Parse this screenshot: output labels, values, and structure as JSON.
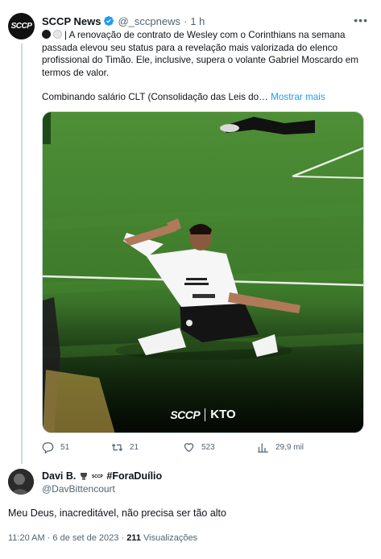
{
  "tweet": {
    "author_name": "SCCP News",
    "avatar_text": "SCCP",
    "handle": "@_sccpnews",
    "separator": "·",
    "time": "1 h",
    "text_para1": "| A renovação de contrato de Wesley com o Corinthians na semana passada elevou seu status para a revelação mais valorizada do elenco profissional do Timão. Ele, inclusive, supera o volante Gabriel Moscardo em termos de valor.",
    "text_para2": "Combinando salário CLT (Consolidação das Leis do…",
    "show_more": "Mostrar mais",
    "image_watermark": "SCCP | KTO",
    "image_watermark_left": "SCCP",
    "image_watermark_right": "KTO",
    "sponsor": "KTO",
    "actions": {
      "replies": "51",
      "retweets": "21",
      "likes": "523",
      "views": "29,9 mil"
    }
  },
  "reply": {
    "author_name": "Davi B.",
    "name_badge": "#ForaDuílio",
    "handle": "@DavBittencourt",
    "text": "Meu Deus, inacreditável, não precisa ser tão alto",
    "timestamp": "11:20 AM · 6 de set de 2023 ·",
    "views_count": "211",
    "views_label": "Visualizações"
  },
  "icons": {
    "verified": "verified-badge-icon",
    "more": "more-icon",
    "reply": "reply-icon",
    "retweet": "retweet-icon",
    "like": "heart-icon",
    "views": "views-chart-icon"
  },
  "colors": {
    "accent": "#1d9bf0",
    "text": "#0f1419",
    "muted": "#536471",
    "pitch": "#3f7a2e"
  }
}
